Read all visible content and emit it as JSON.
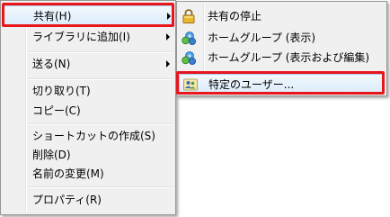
{
  "main_menu": {
    "items": [
      {
        "label": "共有(H)",
        "has_submenu": true,
        "highlighted": true
      },
      {
        "label": "ライブラリに追加(I)",
        "has_submenu": true
      },
      {
        "label": "送る(N)",
        "has_submenu": true
      },
      {
        "label": "切り取り(T)"
      },
      {
        "label": "コピー(C)"
      },
      {
        "label": "ショートカットの作成(S)"
      },
      {
        "label": "削除(D)"
      },
      {
        "label": "名前の変更(M)"
      },
      {
        "label": "プロパティ(R)"
      }
    ]
  },
  "share_submenu": {
    "items": [
      {
        "label": "共有の停止",
        "icon": "lock-icon"
      },
      {
        "label": "ホームグループ (表示)",
        "icon": "homegroup-icon"
      },
      {
        "label": "ホームグループ (表示および編集)",
        "icon": "homegroup-icon"
      },
      {
        "label": "特定のユーザー...",
        "icon": "users-icon",
        "highlighted": true
      }
    ]
  },
  "colors": {
    "highlight_border": "#e8151b",
    "menu_background": "#f0f0f0"
  }
}
